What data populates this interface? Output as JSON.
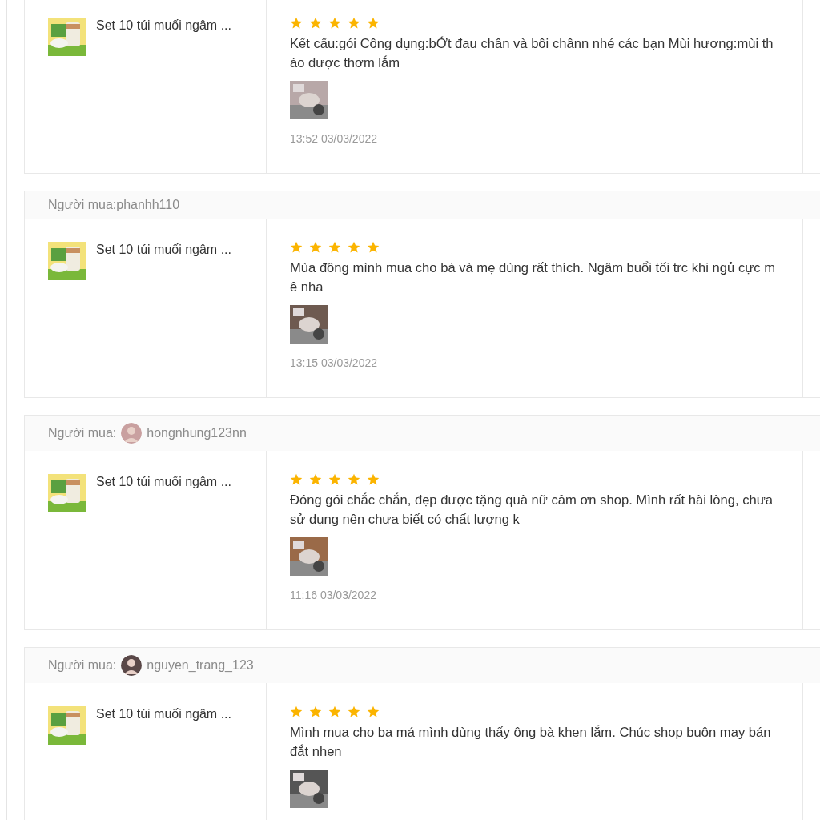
{
  "reviews": [
    {
      "product": {
        "name": "Set 10 túi muối ngâm ..."
      },
      "stars": 5,
      "comment": "Kết cấu:gói Công dụng:bỚt đau chân và bôi chânn nhé các bạn Mùi hương:mùi thảo dược thơm lắm",
      "time": "13:52 03/03/2022"
    },
    {
      "buyer": {
        "kind": "plain",
        "label": "Người mua:",
        "username": "phanhh110"
      },
      "product": {
        "name": "Set 10 túi muối ngâm ..."
      },
      "stars": 5,
      "comment": "Mùa đông mình mua cho bà và mẹ dùng rất thích. Ngâm buổi tối trc khi ngủ cực mê nha",
      "time": "13:15 03/03/2022"
    },
    {
      "buyer": {
        "kind": "avatar",
        "label": "Người mua:",
        "username": "hongnhung123nn"
      },
      "product": {
        "name": "Set 10 túi muối ngâm ..."
      },
      "stars": 5,
      "comment": "Đóng gói chắc chắn, đẹp được tặng quà nữ cảm ơn shop. Mình rất hài lòng, chưa sử dụng nên chưa biết có chất lượng k",
      "time": "11:16 03/03/2022"
    },
    {
      "buyer": {
        "kind": "avatar",
        "label": "Người mua:",
        "username": "nguyen_trang_123"
      },
      "product": {
        "name": "Set 10 túi muối ngâm ..."
      },
      "stars": 5,
      "comment": "Mình mua cho ba má mình dùng thấy ông bà khen lắm. Chúc shop buôn may bán đắt nhen"
    }
  ]
}
